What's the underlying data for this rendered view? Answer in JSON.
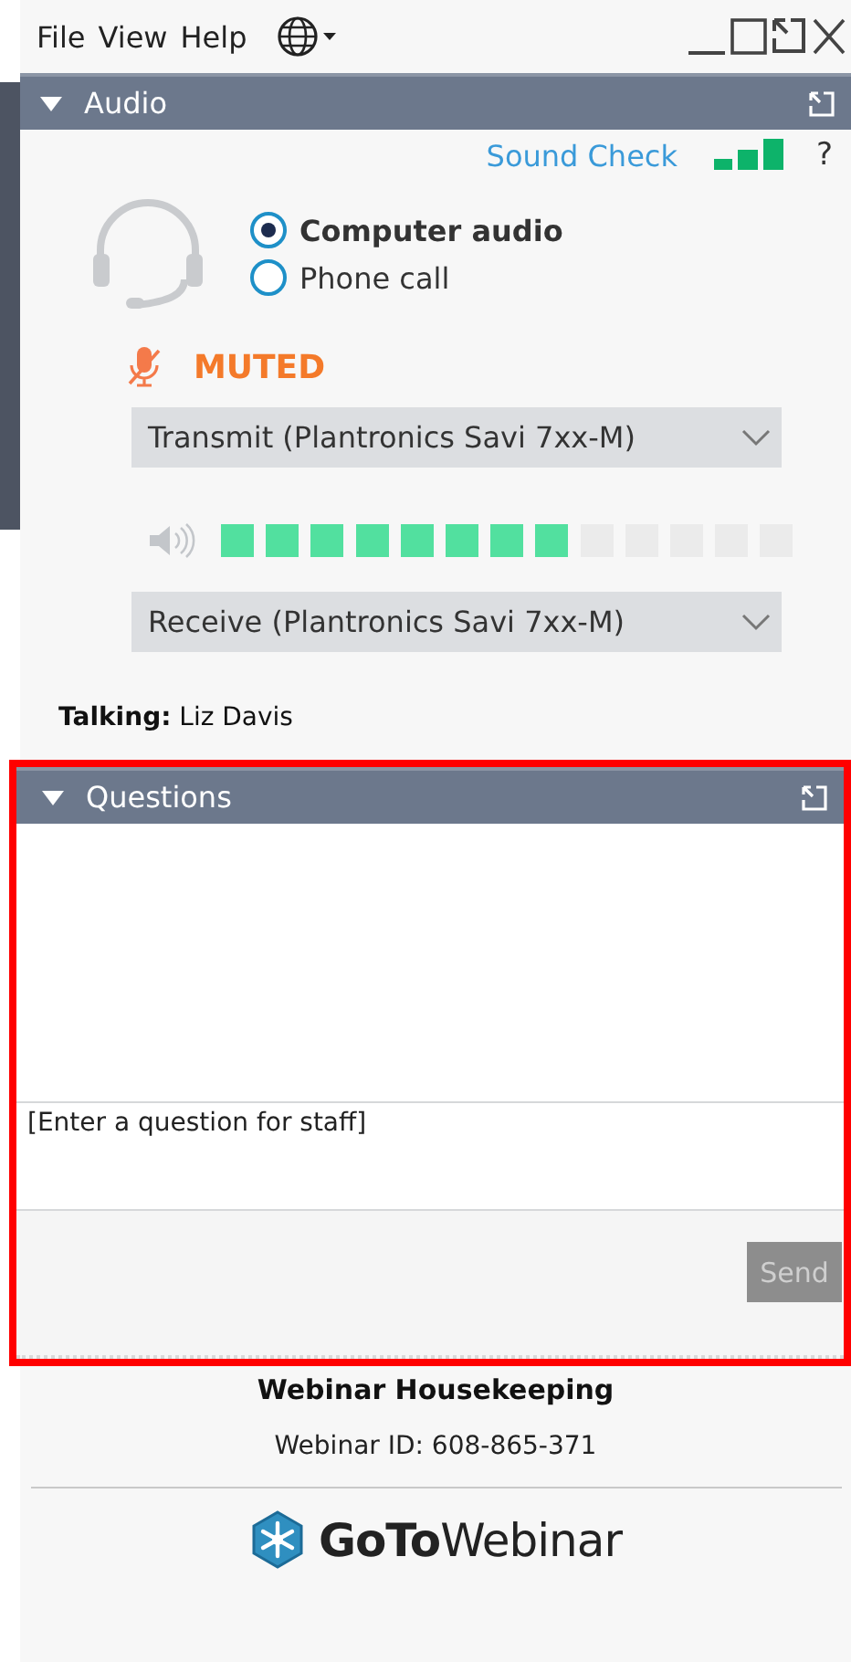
{
  "menu": [
    {
      "label": "File"
    },
    {
      "label": "View"
    },
    {
      "label": "Help"
    }
  ],
  "audio": {
    "title": "Audio",
    "expanded": true,
    "sound_check": "Sound Check",
    "help": "?",
    "options": [
      {
        "label": "Computer audio",
        "selected": true
      },
      {
        "label": "Phone call",
        "selected": false
      }
    ],
    "mute_status": "MUTED",
    "muted": true,
    "transmit": "Transmit (Plantronics Savi 7xx-M)",
    "speaker": {
      "level": 0.615
    },
    "receive": "Receive (Plantronics Savi 7xx-M)"
  },
  "talking": {
    "label": "Talking:",
    "name": "Liz Davis"
  },
  "questions": {
    "title": "Questions",
    "expanded": true,
    "highlighted": true,
    "placeholder": "[Enter a question for staff]",
    "send": "Send",
    "send_disabled": true
  },
  "footer": {
    "title": "Webinar Housekeeping",
    "webinar_id": "Webinar ID: 608-865-371",
    "logo": "**GoTo**Webinar"
  }
}
